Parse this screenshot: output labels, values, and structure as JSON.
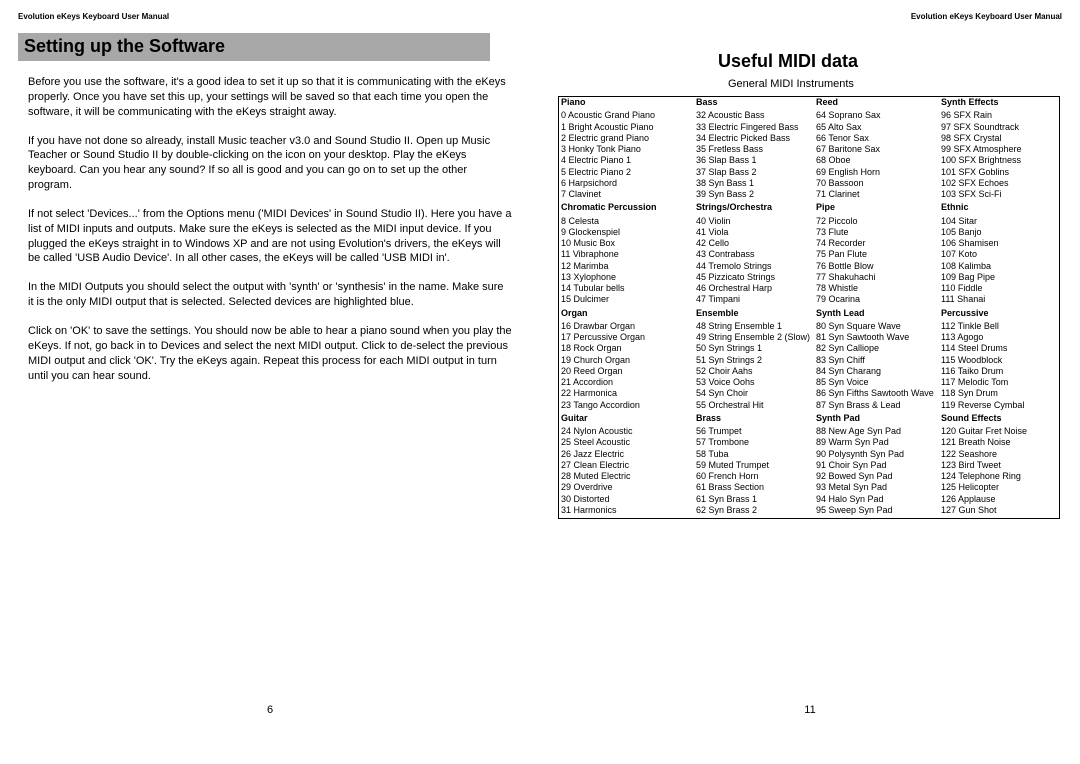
{
  "header": "Evolution eKeys Keyboard User Manual",
  "left": {
    "section_title": "Setting up the Software",
    "paragraphs": [
      "Before you use the software, it's a good idea to set it up so that it is communicating with the eKeys properly.  Once you have set this up, your settings will be saved so that each time you open the software, it will be communicating with the eKeys straight away.",
      "If you have not done so already, install Music teacher v3.0 and Sound Studio II.  Open up Music Teacher or Sound Studio II by double-clicking on the icon on your desktop. Play the eKeys keyboard.  Can you hear any sound?  If so all is good and you can go on to set up the other program.",
      "If not select 'Devices...' from the Options menu ('MIDI Devices' in Sound Studio II).  Here you have a list of MIDI inputs and outputs.  Make sure the eKeys is selected as the MIDI input device. If you plugged the eKeys straight in to Windows XP and are not using Evolution's drivers, the eKeys will be called 'USB Audio Device'.  In all other cases, the eKeys will be called 'USB MIDI in'.",
      "In the MIDI Outputs you should select the output with 'synth' or 'synthesis' in the name.  Make sure it is the only MIDI output that is selected.  Selected devices are highlighted blue.",
      "Click on 'OK' to save the settings.  You should now be able to hear a piano sound when you play the eKeys.  If not, go back in to Devices and select the next MIDI output. Click to de-select the previous MIDI output and click 'OK'. Try the eKeys again. Repeat this process for each MIDI output in turn until you can hear sound."
    ],
    "page_num": "6"
  },
  "right": {
    "title": "Useful MIDI data",
    "subtitle": "General MIDI Instruments",
    "groups": [
      {
        "headers": [
          "Piano",
          "Bass",
          "Reed",
          "Synth Effects"
        ],
        "cols": [
          [
            "0 Acoustic Grand Piano",
            "1 Bright Acoustic Piano",
            "2 Electric grand Piano",
            "3 Honky Tonk Piano",
            "4 Electric Piano 1",
            "5 Electric Piano 2",
            "6 Harpsichord",
            "7 Clavinet"
          ],
          [
            "32 Acoustic Bass",
            "33 Electric Fingered Bass",
            "34 Electric Picked Bass",
            "35 Fretless Bass",
            "36 Slap Bass 1",
            "37 Slap Bass 2",
            "38 Syn Bass 1",
            "39 Syn Bass 2"
          ],
          [
            "64 Soprano Sax",
            "65 Alto Sax",
            "66 Tenor Sax",
            "67 Baritone Sax",
            "68 Oboe",
            "69 English Horn",
            "70 Bassoon",
            "71 Clarinet"
          ],
          [
            "96 SFX Rain",
            "97 SFX Soundtrack",
            "98 SFX Crystal",
            "99 SFX Atmosphere",
            "100 SFX Brightness",
            "101 SFX Goblins",
            "102 SFX Echoes",
            "103 SFX Sci-Fi"
          ]
        ]
      },
      {
        "headers": [
          "Chromatic Percussion",
          "Strings/Orchestra",
          "Pipe",
          "Ethnic"
        ],
        "cols": [
          [
            "8 Celesta",
            "9 Glockenspiel",
            "10 Music Box",
            "11 Vibraphone",
            "12 Marimba",
            "13 Xylophone",
            "14 Tubular bells",
            "15 Dulcimer"
          ],
          [
            "40 Violin",
            "41 Viola",
            "42 Cello",
            "43 Contrabass",
            "44 Tremolo Strings",
            "45 Pizzicato Strings",
            "46 Orchestral Harp",
            "47 Timpani"
          ],
          [
            "72 Piccolo",
            "73 Flute",
            "74 Recorder",
            "75 Pan Flute",
            "76 Bottle Blow",
            "77 Shakuhachi",
            "78 Whistle",
            "79 Ocarina"
          ],
          [
            "104 Sitar",
            "105 Banjo",
            "106 Shamisen",
            "107 Koto",
            "108 Kalimba",
            "109 Bag Pipe",
            "110 Fiddle",
            "111 Shanai"
          ]
        ]
      },
      {
        "headers": [
          "Organ",
          "Ensemble",
          "Synth Lead",
          "Percussive"
        ],
        "cols": [
          [
            "16 Drawbar Organ",
            "17 Percussive Organ",
            "18 Rock Organ",
            "19 Church Organ",
            "20 Reed Organ",
            "21 Accordion",
            "22 Harmonica",
            "23 Tango Accordion"
          ],
          [
            "48 String Ensemble 1",
            "49 String Ensemble 2 (Slow)",
            "50 Syn Strings 1",
            "51 Syn Strings 2",
            "52 Choir Aahs",
            "53 Voice Oohs",
            "54 Syn Choir",
            "55 Orchestral Hit"
          ],
          [
            "80 Syn Square Wave",
            "81 Syn Sawtooth Wave",
            "82 Syn Calliope",
            "83 Syn Chiff",
            "84 Syn Charang",
            "85 Syn Voice",
            "86 Syn Fifths Sawtooth Wave",
            "87 Syn Brass & Lead"
          ],
          [
            "112 Tinkle Bell",
            "113 Agogo",
            "114 Steel Drums",
            "115 Woodblock",
            "116 Taiko Drum",
            "117 Melodic Tom",
            "118 Syn Drum",
            "119 Reverse Cymbal"
          ]
        ]
      },
      {
        "headers": [
          "Guitar",
          "Brass",
          "Synth Pad",
          "Sound Effects"
        ],
        "cols": [
          [
            "24 Nylon Acoustic",
            "25 Steel Acoustic",
            "26 Jazz Electric",
            "27 Clean Electric",
            "28 Muted Electric",
            "29 Overdrive",
            "30 Distorted",
            "31 Harmonics"
          ],
          [
            "56 Trumpet",
            "57 Trombone",
            "58 Tuba",
            "59 Muted Trumpet",
            "60 French Horn",
            "61 Brass Section",
            "61 Syn Brass 1",
            "62 Syn Brass 2"
          ],
          [
            "88 New Age Syn Pad",
            "89 Warm Syn Pad",
            "90 Polysynth Syn Pad",
            "91 Choir Syn Pad",
            "92 Bowed Syn Pad",
            "93 Metal Syn Pad",
            "94 Halo Syn Pad",
            "95 Sweep Syn Pad"
          ],
          [
            "120 Guitar Fret Noise",
            "121 Breath Noise",
            "122 Seashore",
            "123 Bird Tweet",
            "124 Telephone Ring",
            "125 Helicopter",
            "126 Applause",
            "127 Gun Shot"
          ]
        ]
      }
    ],
    "page_num": "11"
  }
}
